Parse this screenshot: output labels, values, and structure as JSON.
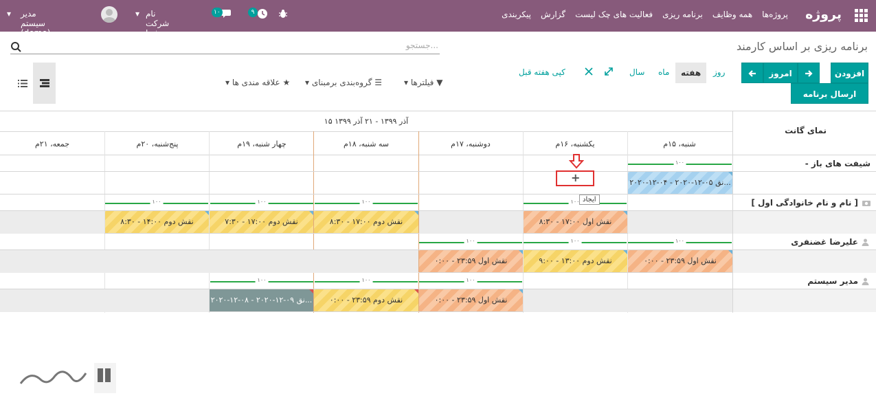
{
  "navbar": {
    "brand": "پروژه",
    "menus": [
      "پروژه‌ها",
      "همه وظایف",
      "برنامه ریزی",
      "فعالیت های چک لیست",
      "گزارش",
      "پیکربندی"
    ],
    "company": "نام شرکت شما",
    "user": "مدیر سیستم (demo)",
    "activity_count": "۹",
    "message_count": "۱۰"
  },
  "page": {
    "title": "برنامه ریزی بر اساس کارمند",
    "search_placeholder": "جستجو..."
  },
  "controls": {
    "add": "افزودن",
    "today": "امروز",
    "send_schedule": "ارسال برنامه زمانی",
    "scales": {
      "day": "روز",
      "week": "هفته",
      "month": "ماه",
      "year": "سال"
    },
    "copy_previous_week": "کپی هفته قبل",
    "filters": "فیلترها",
    "group_by": "گروه‌بندی برمبنای",
    "favorites": "علاقه مندی ها"
  },
  "gantt": {
    "header_label": "نمای گانت",
    "range": "۱۵ آذر ۱۳۹۹ - ۲۱ آذر ۱۳۹۹",
    "days": [
      "شنبه، ۱۵م",
      "یکشنبه، ۱۶م",
      "دوشنبه، ۱۷م",
      "سه شنبه، ۱۸م",
      "چهار شنبه، ۱۹م",
      "پنج‌شنبه، ۲۰م",
      "جمعه، ۲۱م"
    ],
    "rows": [
      {
        "label": "- شیفت های باز"
      },
      {
        "label": "[ نام و نام خانوادگی اول ]"
      },
      {
        "label": "علیرضا غضنفری"
      },
      {
        "label": "مدیر سیستم"
      }
    ],
    "allocation": "۱۰۰",
    "pills": {
      "open_shift": "۲۰۲۰-۱۲-۰۴ - ۲۰۲۰-۱۲-۰۵ نق...",
      "r1_d1": "۸:۳۰ - ۱۷:۰۰ نقش اول",
      "r1_d3": "۸:۳۰ - ۱۷:۰۰ نقش دوم",
      "r1_d4": "۷:۳۰ - ۱۷:۰۰ نقش دوم",
      "r1_d5": "۸:۳۰ - ۱۴:۰۰ نقش دوم",
      "r2_d0": "۰:۰۰ - ۲۳:۵۹ نقش اول",
      "r2_d1": "۹:۰۰ - ۱۳:۰۰ نقش دوم",
      "r2_d2": "۰:۰۰ - ۲۳:۵۹ نقش اول",
      "r3_d2": "۰:۰۰ - ۲۳:۵۹ نقش اول",
      "r3_d3": "۰:۰۰ - ۲۳:۵۹ نقش دوم",
      "r3_d4": "۲۰۲۰-۱۲-۰۸ - ۲۰۲۰-۱۲-۰۹ نق..."
    },
    "create_button": "+",
    "create_tooltip": "ایجاد"
  },
  "colors": {
    "brand": "#875a7b",
    "accent": "#00a09d"
  }
}
